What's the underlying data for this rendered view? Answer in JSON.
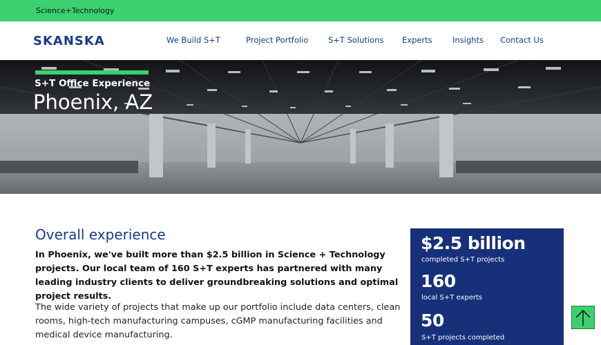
{
  "topbar": {
    "label": "Science+Technology"
  },
  "header": {
    "logo": "SKANSKA",
    "nav": [
      {
        "label": "We Build S+T"
      },
      {
        "label": "Project Portfolio"
      },
      {
        "label": "S+T Solutions"
      },
      {
        "label": "Experts"
      },
      {
        "label": "Insights"
      },
      {
        "label": "Contact Us"
      }
    ]
  },
  "hero": {
    "kicker": "S+T Office Experience",
    "title": "Phoenix, AZ"
  },
  "main": {
    "section_title": "Overall experience",
    "lead": "In Phoenix, we've built more than $2.5 billion in Science + Technology projects. Our local team of 160 S+T experts has partnered with many leading industry clients to deliver groundbreaking solutions and optimal project results.",
    "body": "The wide variety of projects that make up our portfolio include data centers, clean rooms, high-tech manufacturing campuses, cGMP manufacturing facilities and medical device manufacturing."
  },
  "stats": [
    {
      "value": "$2.5 billion",
      "label": "completed S+T projects"
    },
    {
      "value": "160",
      "label": "local S+T experts"
    },
    {
      "value": "50",
      "label": "S+T projects completed"
    }
  ],
  "colors": {
    "accent_green": "#3cd070",
    "brand_blue": "#143c8a",
    "stats_bg": "#17307a"
  },
  "icons": {
    "back_to_top": "arrow-up-icon"
  }
}
